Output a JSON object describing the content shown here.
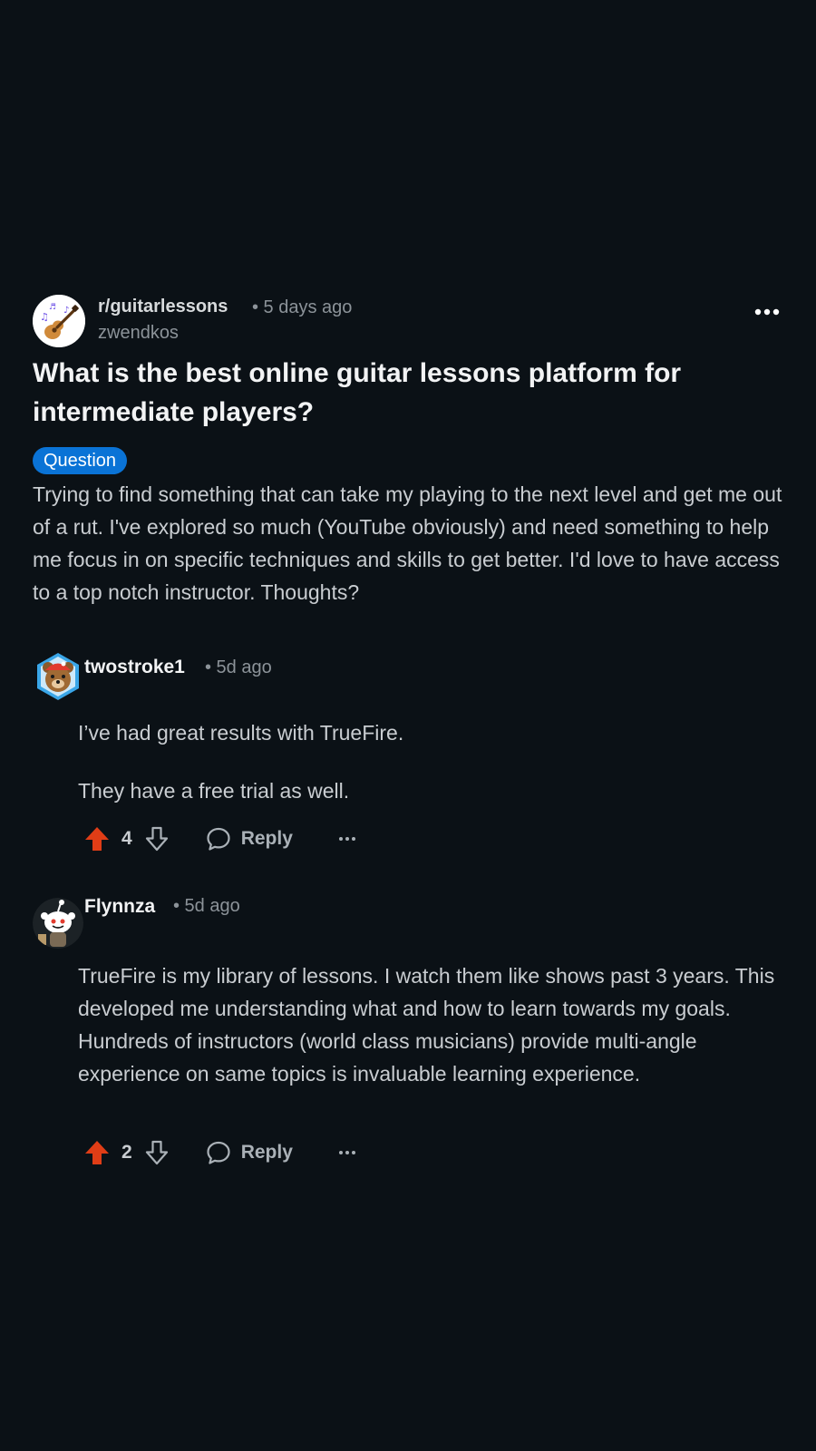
{
  "post": {
    "subreddit": "r/guitarlessons",
    "time": "• 5 days ago",
    "author": "zwendkos",
    "title": "What is the best online guitar lessons platform for intermediate players?",
    "flair": "Question",
    "body": "Trying to find something that can take my playing to the next level and get me out of a rut. I've explored so much (YouTube obviously) and need something to help me focus in on specific techniques and skills to get better. I'd love to have access to a top notch instructor. Thoughts?"
  },
  "comments": [
    {
      "user": "twostroke1",
      "time": "• 5d ago",
      "paragraphs": [
        "I’ve had great results with TrueFire.",
        "They have a free trial as well."
      ],
      "votes": "4",
      "reply_label": "Reply"
    },
    {
      "user": "Flynnza",
      "time": "• 5d ago",
      "paragraphs": [
        "TrueFire is my library of lessons. I watch them like shows past 3 years. This developed me understanding what and how to learn towards my goals. Hundreds of instructors (world class musicians) provide multi-angle experience on same topics is invaluable learning experience."
      ],
      "votes": "2",
      "reply_label": "Reply"
    }
  ],
  "colors": {
    "background": "#0b1116",
    "upvote_active": "#e03d16",
    "flair": "#0a73d6",
    "meta_text": "#8c9399"
  },
  "icons": {
    "upvote": "upvote-filled-icon",
    "downvote": "downvote-outline-icon",
    "reply": "speech-bubble-icon",
    "more": "ellipsis-icon"
  }
}
